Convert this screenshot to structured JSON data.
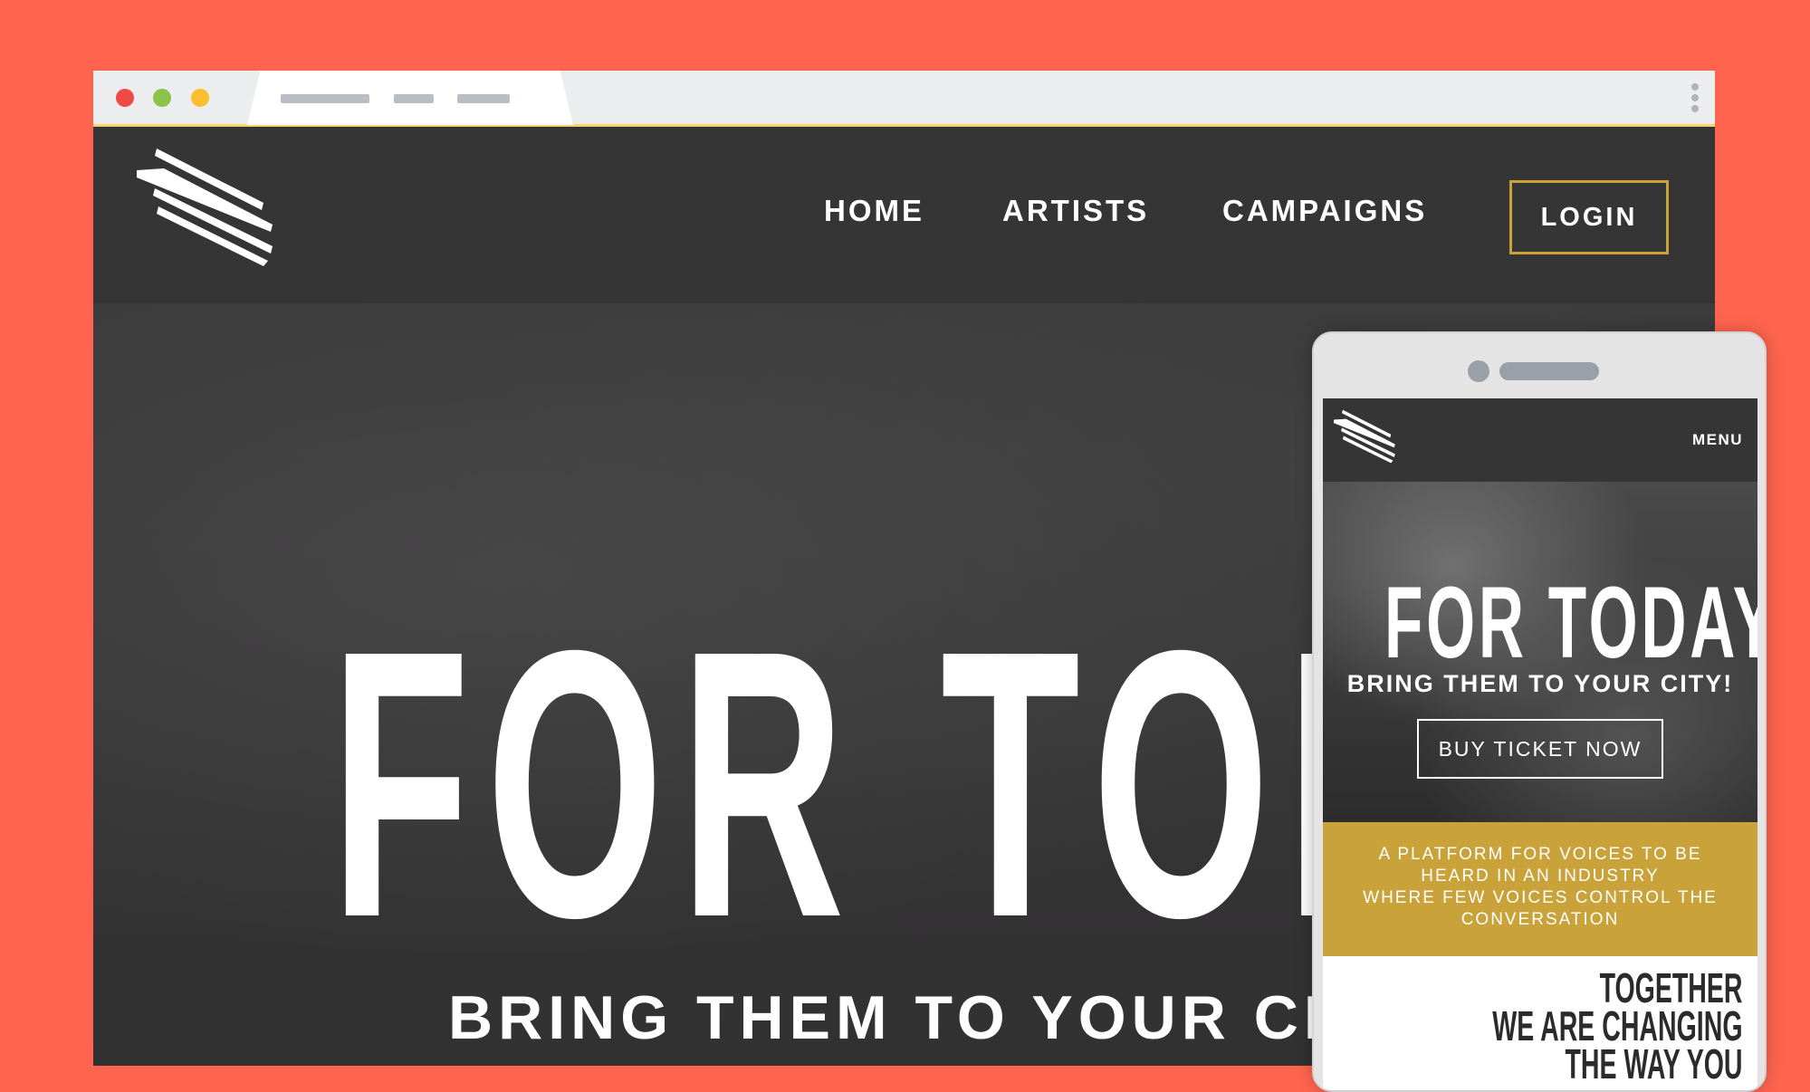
{
  "colors": {
    "background": "#FF654E",
    "header": "#363536",
    "accent_gold": "#C9A23A",
    "traffic_red": "#F04A44",
    "traffic_green": "#8BC34A",
    "traffic_yellow": "#FBBF2F"
  },
  "desktop": {
    "nav": [
      "HOME",
      "ARTISTS",
      "CAMPAIGNS"
    ],
    "login_label": "LOGIN",
    "hero_title": "FOR TODA",
    "hero_subtitle": "BRING THEM TO YOUR CITY"
  },
  "mobile": {
    "menu_label": "MENU",
    "hero_title": "FOR TODAY",
    "hero_subtitle": "BRING THEM TO YOUR CITY!",
    "cta_label": "BUY TICKET NOW",
    "tagline_lines": [
      "A PLATFORM FOR VOICES TO BE",
      "HEARD IN AN INDUSTRY",
      "WHERE FEW VOICES CONTROL THE",
      "CONVERSATION"
    ],
    "headline_lines": [
      "TOGETHER",
      "WE ARE CHANGING",
      "THE WAY YOU"
    ]
  }
}
